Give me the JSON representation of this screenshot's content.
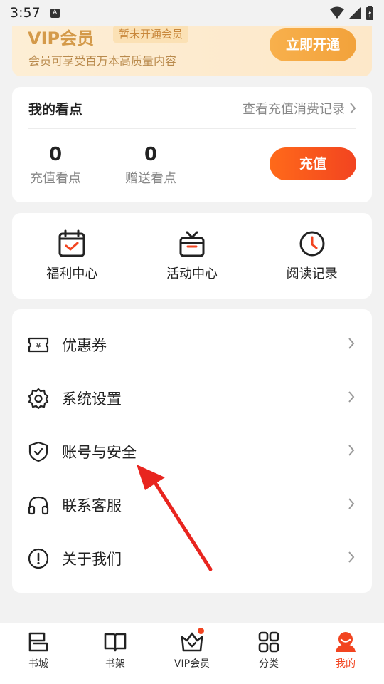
{
  "status_bar": {
    "time": "3:57",
    "notification_letter": "A"
  },
  "vip_banner": {
    "title": "VIP会员",
    "status_badge": "暂未开通会员",
    "description": "会员可享受百万本高质量内容",
    "open_button": "立即开通"
  },
  "points": {
    "title": "我的看点",
    "history_link": "查看充值消费记录",
    "recharge_points": {
      "value": "0",
      "label": "充值看点"
    },
    "gift_points": {
      "value": "0",
      "label": "赠送看点"
    },
    "recharge_button": "充值"
  },
  "quick_actions": [
    {
      "label": "福利中心",
      "icon": "calendar-check-icon"
    },
    {
      "label": "活动中心",
      "icon": "gift-box-icon"
    },
    {
      "label": "阅读记录",
      "icon": "clock-icon"
    }
  ],
  "menu": [
    {
      "label": "优惠券",
      "icon": "coupon-icon"
    },
    {
      "label": "系统设置",
      "icon": "gear-icon"
    },
    {
      "label": "账号与安全",
      "icon": "shield-check-icon"
    },
    {
      "label": "联系客服",
      "icon": "headphones-icon"
    },
    {
      "label": "关于我们",
      "icon": "info-exclamation-icon"
    }
  ],
  "bottom_nav": [
    {
      "label": "书城",
      "icon": "bookstore-icon",
      "active": false
    },
    {
      "label": "书架",
      "icon": "book-open-icon",
      "active": false
    },
    {
      "label": "VIP会员",
      "icon": "crown-icon",
      "active": false,
      "badge_dot": true
    },
    {
      "label": "分类",
      "icon": "grid-icon",
      "active": false
    },
    {
      "label": "我的",
      "icon": "profile-icon",
      "active": true
    }
  ],
  "colors": {
    "accent": "#f24420",
    "vip_gold": "#d49a4a",
    "vip_button": "#f5a940",
    "annotation_arrow": "#e8251f"
  }
}
